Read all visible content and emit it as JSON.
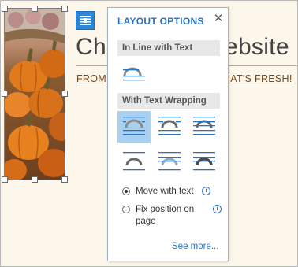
{
  "document": {
    "title": "Ch",
    "title_right": "ebsite",
    "subtitle_left": "From",
    "subtitle_right": "that's fresh!"
  },
  "popup": {
    "title": "LAYOUT OPTIONS",
    "close_icon": "close-icon",
    "section_inline": "In Line with Text",
    "section_wrapping": "With Text Wrapping",
    "radio_move_prefix": "",
    "radio_move_u": "M",
    "radio_move_rest": "ove with text",
    "radio_fix_line1_pre": "Fix position ",
    "radio_fix_line1_u": "o",
    "radio_fix_line1_post": "n",
    "radio_fix_line2": "page",
    "see_more": "See more...",
    "selected_radio": "move-with-text"
  },
  "colors": {
    "accent": "#2b73c0",
    "selected_bg": "#a9d0ef",
    "page_bg": "#fdf6ea"
  }
}
